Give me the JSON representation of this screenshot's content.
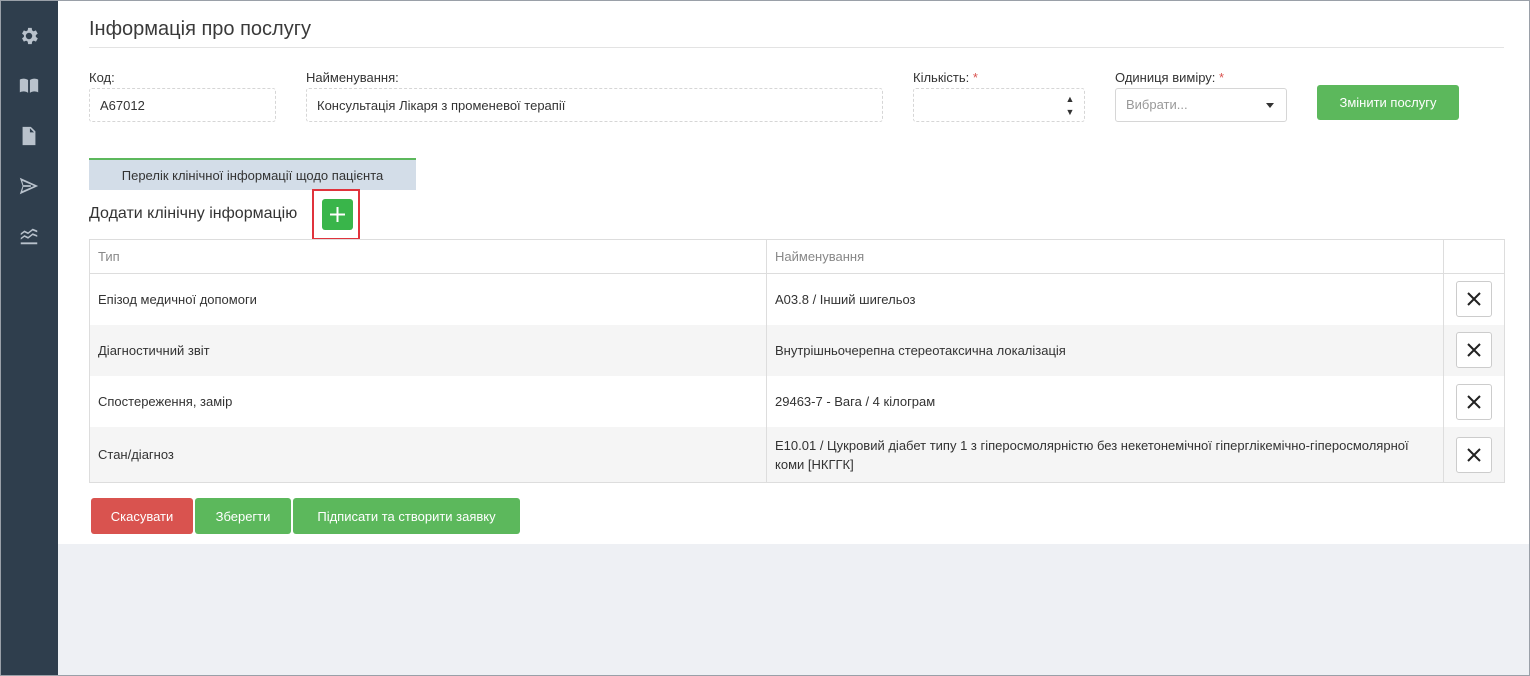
{
  "page": {
    "title": "Інформація про послугу"
  },
  "fields": {
    "code": {
      "label": "Код:",
      "value": "A67012"
    },
    "name": {
      "label": "Найменування:",
      "value": "Консультація Лікаря з променевої терапії"
    },
    "quantity": {
      "label": "Кількість:",
      "required_mark": "*",
      "value": ""
    },
    "unit": {
      "label": "Одиниця виміру:",
      "required_mark": "*",
      "placeholder": "Вибрати..."
    }
  },
  "buttons": {
    "change_service": "Змінити послугу",
    "cancel": "Скасувати",
    "save": "Зберегти",
    "sign_create": "Підписати та створити заявку"
  },
  "tab": {
    "label": "Перелік клінічної інформації щодо пацієнта"
  },
  "section": {
    "label": "Додати клінічну інформацію"
  },
  "table": {
    "columns": [
      "Тип",
      "Найменування",
      ""
    ],
    "rows": [
      {
        "type": "Епізод медичної допомоги",
        "name": "A03.8 / Інший шигельоз"
      },
      {
        "type": "Діагностичний звіт",
        "name": "Внутрішньочерепна стереотаксична локалізація"
      },
      {
        "type": "Спостереження, замір",
        "name": "29463-7 - Вага / 4 кілограм"
      },
      {
        "type": "Стан/діагноз",
        "name": "E10.01 / Цукровий діабет типу 1 з гіперосмолярністю без некетонемічної гіперглікемічно-гіперосмолярної коми [НКГГК]"
      }
    ]
  },
  "sidebar": {
    "icons": [
      "gear-icon",
      "book-icon",
      "document-check-icon",
      "send-icon",
      "chart-lines-icon"
    ]
  },
  "colors": {
    "sidebar_bg": "#2f3e4d",
    "accent_green": "#5cb85c",
    "danger_red": "#d9534f",
    "highlight_red": "#e0333c",
    "tab_bg": "#d3dde8"
  }
}
